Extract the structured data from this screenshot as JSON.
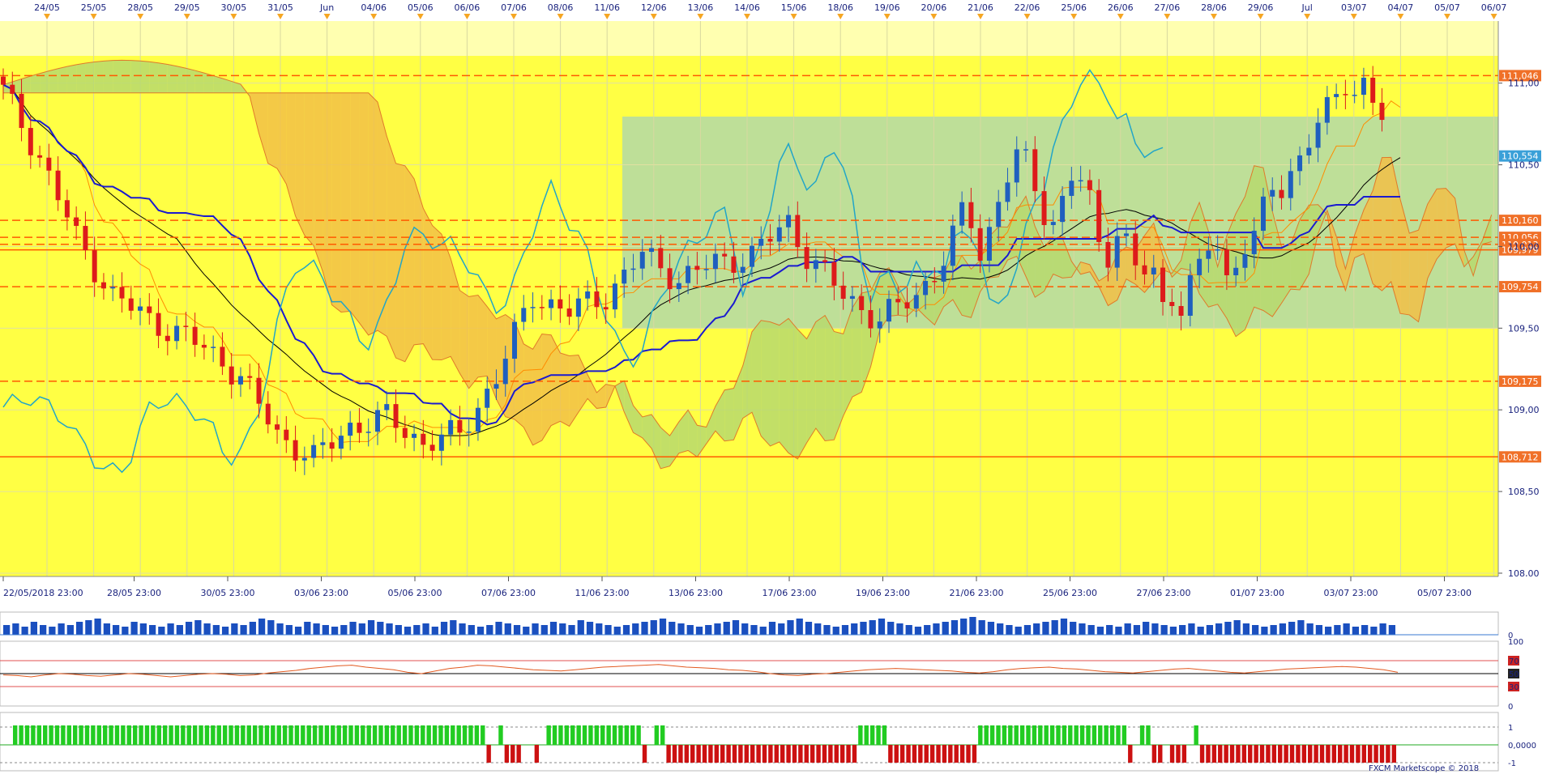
{
  "chart_data": {
    "type": "candlestick",
    "top_dates": [
      "24/05",
      "25/05",
      "28/05",
      "29/05",
      "30/05",
      "31/05",
      "Jun",
      "04/06",
      "05/06",
      "06/06",
      "07/06",
      "08/06",
      "11/06",
      "12/06",
      "13/06",
      "14/06",
      "15/06",
      "18/06",
      "19/06",
      "20/06",
      "21/06",
      "22/06",
      "25/06",
      "26/06",
      "27/06",
      "28/06",
      "29/06",
      "Jul",
      "03/07",
      "04/07",
      "05/07",
      "06/07"
    ],
    "bottom_dates": [
      "22/05/2018 23:00",
      "28/05 23:00",
      "30/05 23:00",
      "03/06 23:00",
      "05/06 23:00",
      "07/06 23:00",
      "11/06 23:00",
      "13/06 23:00",
      "17/06 23:00",
      "19/06 23:00",
      "21/06 23:00",
      "25/06 23:00",
      "27/06 23:00",
      "01/07 23:00",
      "03/07 23:00",
      "05/07 23:00"
    ],
    "price_ticks": [
      "111,00",
      "110,50",
      "110,00",
      "109,50",
      "109,00",
      "108,50",
      "108,00"
    ],
    "ylim": [
      107.98,
      111.38
    ],
    "levels": [
      {
        "label": "111,046",
        "value": 111.046,
        "style": "dashed"
      },
      {
        "label": "110,160",
        "value": 110.16,
        "style": "dashed"
      },
      {
        "label": "110,056",
        "value": 110.056,
        "style": "dashed"
      },
      {
        "label": "110,013",
        "value": 110.013,
        "style": "dashed"
      },
      {
        "label": "109,979",
        "value": 109.979,
        "style": "solid"
      },
      {
        "label": "109,754",
        "value": 109.754,
        "style": "dashed"
      },
      {
        "label": "109,175",
        "value": 109.175,
        "style": "dashed"
      },
      {
        "label": "108,712",
        "value": 108.712,
        "style": "solid"
      }
    ],
    "current_price": "110,554",
    "rsi_ticks": [
      "100",
      "70",
      "50",
      "30",
      "0"
    ],
    "rsi_values": [
      48,
      47,
      45,
      48,
      50,
      49,
      47,
      46,
      48,
      50,
      49,
      47,
      45,
      47,
      49,
      50,
      49,
      47,
      48,
      51,
      53,
      55,
      58,
      60,
      62,
      63,
      60,
      58,
      56,
      52,
      50,
      54,
      58,
      60,
      63,
      62,
      60,
      58,
      56,
      55,
      54,
      56,
      58,
      60,
      61,
      62,
      63,
      64,
      62,
      60,
      59,
      58,
      56,
      55,
      53,
      50,
      48,
      47,
      49,
      50,
      52,
      54,
      56,
      57,
      58,
      57,
      56,
      55,
      54,
      52,
      51,
      53,
      56,
      58,
      59,
      60,
      58,
      57,
      55,
      53,
      52,
      51,
      53,
      55,
      57,
      58,
      56,
      54,
      52,
      51,
      53,
      55,
      57,
      58,
      59,
      60,
      61,
      60,
      58,
      56,
      52
    ],
    "volume_ticks": [
      "0"
    ],
    "volumes": [
      6,
      7,
      5,
      8,
      6,
      5,
      7,
      6,
      8,
      9,
      10,
      7,
      6,
      5,
      8,
      7,
      6,
      5,
      7,
      6,
      8,
      9,
      7,
      6,
      5,
      7,
      6,
      8,
      10,
      9,
      7,
      6,
      5,
      8,
      7,
      6,
      5,
      6,
      8,
      7,
      9,
      8,
      7,
      6,
      5,
      6,
      7,
      5,
      8,
      9,
      7,
      6,
      5,
      6,
      8,
      7,
      6,
      5,
      7,
      6,
      8,
      7,
      6,
      9,
      8,
      7,
      6,
      5,
      6,
      7,
      8,
      9,
      10,
      8,
      7,
      6,
      5,
      6,
      7,
      8,
      9,
      7,
      6,
      5,
      8,
      7,
      9,
      10,
      8,
      7,
      6,
      5,
      6,
      7,
      8,
      9,
      10,
      8,
      7,
      6,
      5,
      6,
      7,
      8,
      9,
      10,
      11,
      9,
      8,
      7,
      6,
      5,
      6,
      7,
      8,
      9,
      10,
      8,
      7,
      6,
      5,
      6,
      5,
      7,
      6,
      8,
      7,
      6,
      5,
      6,
      7,
      5,
      6,
      7,
      8,
      9,
      7,
      6,
      5,
      6,
      7,
      8,
      9,
      7,
      6,
      5,
      6,
      7,
      5,
      6,
      5,
      7,
      6
    ],
    "osc_ticks": [
      "1",
      "0,0000",
      "-1"
    ],
    "osc_signs": [
      1,
      1,
      1,
      1,
      1,
      1,
      1,
      1,
      1,
      1,
      1,
      1,
      1,
      1,
      1,
      1,
      1,
      1,
      1,
      1,
      1,
      1,
      1,
      1,
      1,
      1,
      1,
      1,
      1,
      1,
      1,
      1,
      1,
      1,
      1,
      1,
      1,
      1,
      1,
      1,
      1,
      1,
      1,
      1,
      1,
      1,
      1,
      1,
      1,
      1,
      1,
      1,
      1,
      1,
      1,
      1,
      1,
      1,
      1,
      1,
      1,
      1,
      1,
      1,
      1,
      1,
      1,
      1,
      1,
      1,
      1,
      1,
      1,
      1,
      1,
      1,
      1,
      1,
      1,
      -1,
      0,
      1,
      -1,
      -1,
      -1,
      0,
      0,
      -1,
      0,
      1,
      1,
      1,
      1,
      1,
      1,
      1,
      1,
      1,
      1,
      1,
      1,
      1,
      1,
      1,
      1,
      -1,
      0,
      1,
      1,
      -1,
      -1,
      -1,
      -1,
      -1,
      -1,
      -1,
      -1,
      -1,
      -1,
      -1,
      -1,
      -1,
      -1,
      -1,
      -1,
      -1,
      -1,
      -1,
      -1,
      -1,
      -1,
      -1,
      -1,
      -1,
      -1,
      -1,
      -1,
      -1,
      -1,
      -1,
      -1,
      1,
      1,
      1,
      1,
      1,
      -1,
      -1,
      -1,
      -1,
      -1,
      -1,
      -1,
      -1,
      -1,
      -1,
      -1,
      -1,
      -1,
      -1,
      -1,
      1,
      1,
      1,
      1,
      1,
      1,
      1,
      1,
      1,
      1,
      1,
      1,
      1,
      1,
      1,
      1,
      1,
      1,
      1,
      1,
      1,
      1,
      1,
      1,
      1,
      -1,
      0,
      1,
      1,
      -1,
      -1,
      0,
      -1,
      -1,
      -1,
      0,
      1,
      -1,
      -1,
      -1,
      -1,
      -1,
      -1,
      -1,
      -1,
      -1,
      -1,
      -1,
      -1,
      -1,
      -1,
      -1,
      -1,
      -1,
      -1,
      -1,
      -1,
      -1,
      -1,
      -1,
      -1,
      -1,
      -1,
      -1,
      -1,
      -1,
      -1,
      -1,
      -1,
      -1
    ],
    "colors": {
      "background": "#ffff44",
      "up": "#1f5fbf",
      "down": "#dd1b1b",
      "kijun": "#1a1ad0",
      "chikou": "#22a5c8",
      "cloud_bull": "#b7d96d",
      "cloud_bear": "#f2c046",
      "level": "#ff5a00",
      "osc_up": "#22cc22",
      "osc_down": "#cc1111"
    },
    "copyright": "FXCM Marketscope © 2018"
  }
}
